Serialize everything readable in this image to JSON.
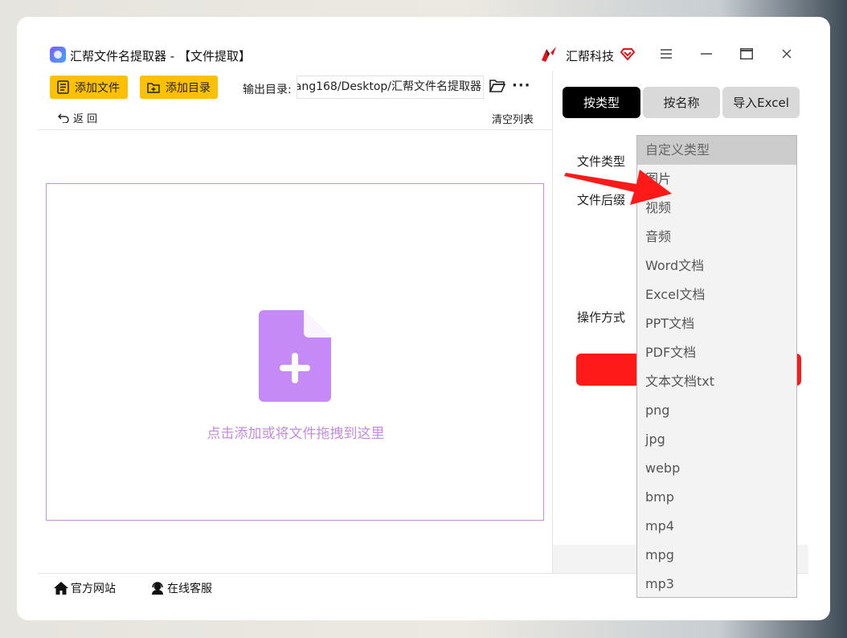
{
  "window": {
    "title": "汇帮文件名提取器 - 【文件提取】",
    "brand": "汇帮科技"
  },
  "toolbar": {
    "add_file": "添加文件",
    "add_dir": "添加目录",
    "output_label": "输出目录:",
    "output_path": "ang168/Desktop/汇帮文件名提取器",
    "back": "返 回",
    "clear": "清空列表"
  },
  "dropzone": {
    "text": "点击添加或将文件拖拽到这里"
  },
  "right_panel": {
    "tabs": [
      {
        "label": "按类型",
        "active": true
      },
      {
        "label": "按名称",
        "active": false
      },
      {
        "label": "导入Excel",
        "active": false
      }
    ],
    "file_type_label": "文件类型",
    "suffix_label": "文件后缀",
    "operation_label": "操作方式"
  },
  "dropdown": {
    "items": [
      "自定义类型",
      "图片",
      "视频",
      "音频",
      "Word文档",
      "Excel文档",
      "PPT文档",
      "PDF文档",
      "文本文档txt",
      "png",
      "jpg",
      "webp",
      "bmp",
      "mp4",
      "mpg",
      "mp3"
    ],
    "selected": "自定义类型"
  },
  "footer": {
    "site": "官方网站",
    "support": "在线客服"
  },
  "colors": {
    "accent_yellow": "#ffc000",
    "tab_active": "#000000",
    "run_button": "#ff1a1a",
    "drop_purple": "#c58be0"
  }
}
